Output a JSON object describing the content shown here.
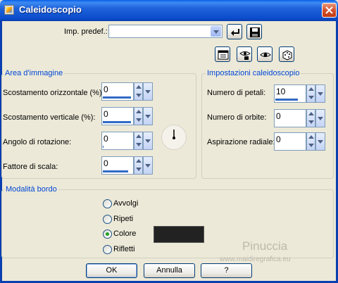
{
  "window": {
    "title": "Caleidoscopio"
  },
  "preset": {
    "label": "Imp. predef.:",
    "value": ""
  },
  "area_immagine": {
    "title": "Area d'immagine",
    "fields": [
      {
        "label": "Scostamento orizzontale (%):",
        "value": "0"
      },
      {
        "label": "Scostamento verticale (%):",
        "value": "0"
      },
      {
        "label": "Angolo di rotazione:",
        "value": "0"
      },
      {
        "label": "Fattore di scala:",
        "value": "0"
      }
    ]
  },
  "impostazioni": {
    "title": "Impostazioni caleidoscopio",
    "fields": [
      {
        "label": "Numero di petali:",
        "value": "10"
      },
      {
        "label": "Numero di orbite:",
        "value": "0"
      },
      {
        "label": "Aspirazione radiale:",
        "value": "0"
      }
    ]
  },
  "modalita_bordo": {
    "title": "Modalità bordo",
    "options": [
      "Avvolgi",
      "Ripeti",
      "Colore",
      "Rifletti"
    ],
    "selected": "Colore",
    "color": "#222222"
  },
  "buttons": {
    "ok": "OK",
    "cancel": "Annulla",
    "help": "?"
  },
  "watermark": {
    "name": "Pinuccia",
    "url": "www.maidiregrafica.eu"
  },
  "icons": [
    "run-script-icon",
    "save-preset-icon",
    "dialog-options-icon",
    "proof-preview-icon",
    "toggle-preview-icon",
    "randomize-icon"
  ],
  "colors": {
    "titlebar": "#0B4DCC",
    "group_title": "#0046D5",
    "slider_fill": "#316AC5",
    "background": "#ECE9D8"
  }
}
